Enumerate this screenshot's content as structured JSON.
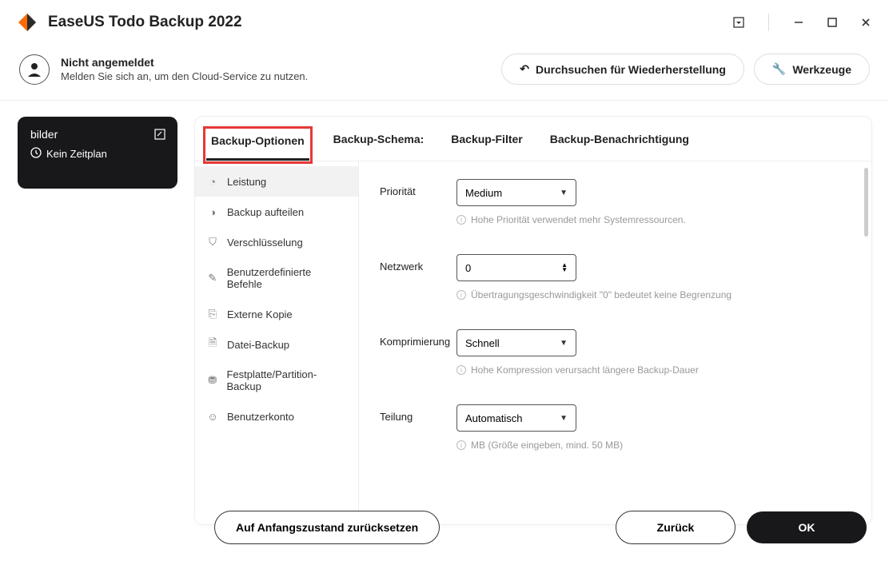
{
  "app": {
    "title": "EaseUS Todo Backup 2022"
  },
  "user": {
    "status": "Nicht angemeldet",
    "subtitle": "Melden Sie sich an, um den Cloud-Service zu nutzen."
  },
  "header_buttons": {
    "browse_restore": "Durchsuchen für Wiederherstellung",
    "tools": "Werkzeuge"
  },
  "side_card": {
    "title": "bilder",
    "schedule": "Kein Zeitplan"
  },
  "tabs": {
    "options": "Backup-Optionen",
    "schema": "Backup-Schema:",
    "filter": "Backup-Filter",
    "notify": "Backup-Benachrichtigung"
  },
  "side_menu": [
    "Leistung",
    "Backup aufteilen",
    "Verschlüsselung",
    "Benutzerdefinierte Befehle",
    "Externe Kopie",
    "Datei-Backup",
    "Festplatte/Partition-Backup",
    "Benutzerkonto"
  ],
  "settings": {
    "priority": {
      "label": "Priorität",
      "value": "Medium",
      "hint": "Hohe Priorität verwendet mehr Systemressourcen."
    },
    "network": {
      "label": "Netzwerk",
      "value": "0",
      "hint": "Übertragungsgeschwindigkeit \"0\" bedeutet keine Begrenzung"
    },
    "compression": {
      "label": "Komprimierung",
      "value": "Schnell",
      "hint": "Hohe Kompression verursacht längere Backup-Dauer"
    },
    "split": {
      "label": "Teilung",
      "value": "Automatisch",
      "hint": "MB (Größe eingeben, mind. 50 MB)"
    }
  },
  "footer": {
    "reset": "Auf Anfangszustand zurücksetzen",
    "back": "Zurück",
    "ok": "OK"
  }
}
